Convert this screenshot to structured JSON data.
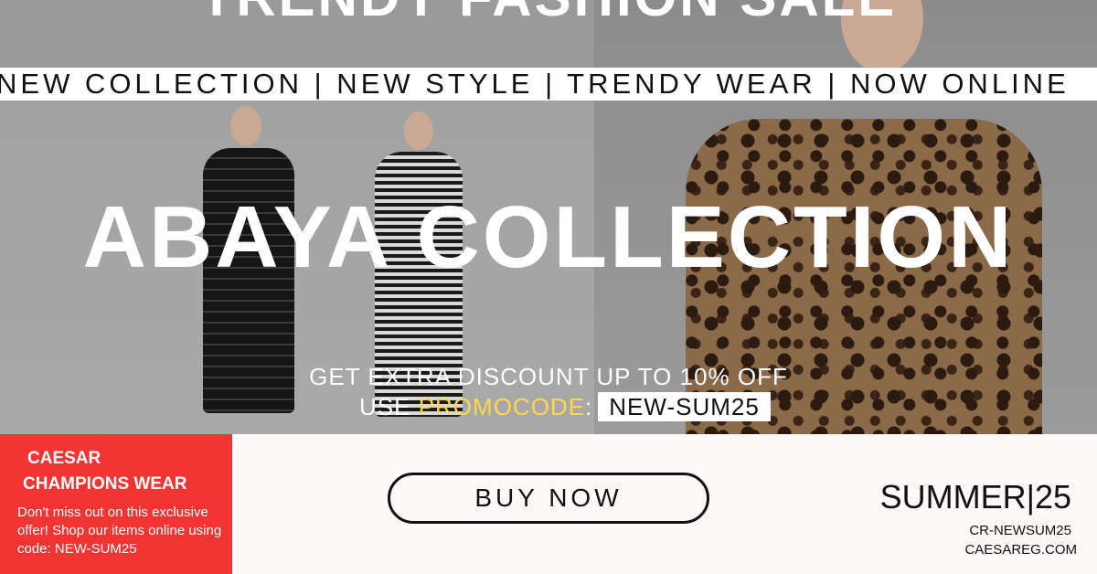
{
  "banner": {
    "top_title": "TRENDY FASHION SALE",
    "ticker": "NEW COLLECTION | NEW STYLE | TRENDY WEAR | NOW ONLINE",
    "main_title": "ABAYA COLLECTION",
    "discount": "GET EXTRA DISCOUNT UP TO 10% OFF",
    "promo_prefix": "USE ",
    "promo_word": "PROMOCODE",
    "promo_colon": ":",
    "promo_code": "NEW-SUM25"
  },
  "footer": {
    "brand_line1": "CAESAR",
    "brand_line2": "CHAMPIONS WEAR",
    "brand_desc": "Don't miss out on this exclusive offer! Shop our items online using code: NEW-SUM25",
    "buy_button": "BUY NOW",
    "season": "SUMMER|25",
    "promo_small": "CR-NEWSUM25",
    "site": "CAESAREG.COM"
  },
  "colors": {
    "accent_red": "#f23432",
    "promo_yellow": "#ffd84a"
  }
}
